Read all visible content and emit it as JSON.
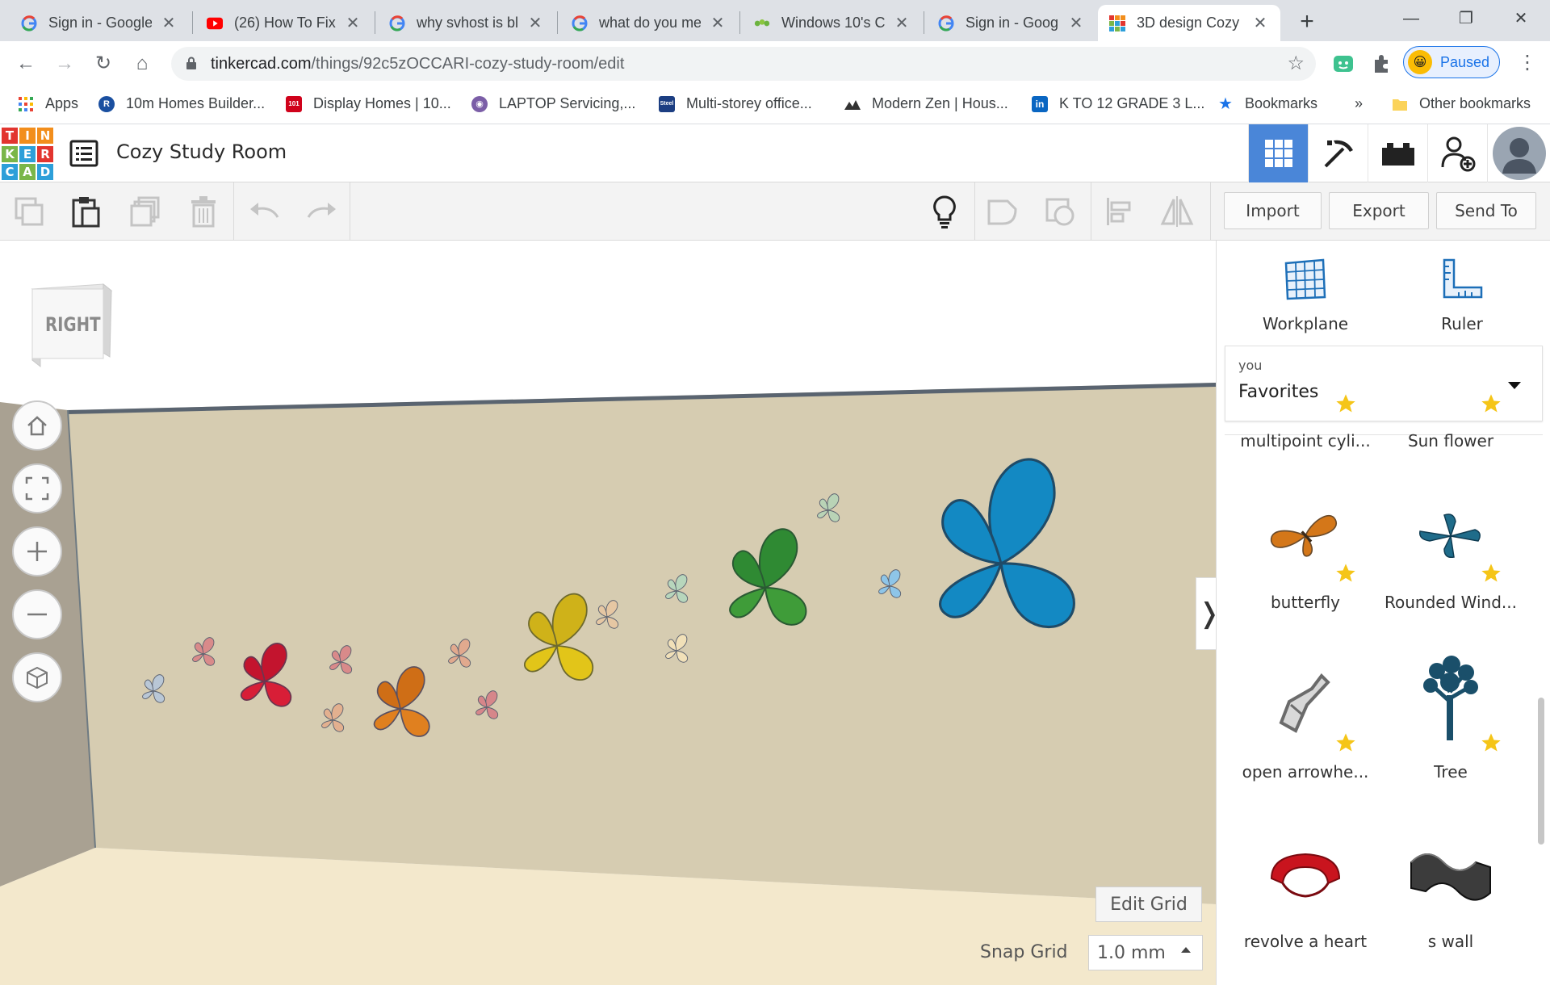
{
  "browser": {
    "tabs": [
      {
        "title": "Sign in - Google",
        "icon": "google-icon"
      },
      {
        "title": "(26) How To Fix",
        "icon": "youtube-icon"
      },
      {
        "title": "why svhost is bl",
        "icon": "google-icon"
      },
      {
        "title": "what do you me",
        "icon": "google-icon"
      },
      {
        "title": "Windows 10's C",
        "icon": "windows10-site-icon"
      },
      {
        "title": "Sign in - Google",
        "icon": "google-icon"
      },
      {
        "title": "3D design Cozy",
        "icon": "tinkercad-icon"
      }
    ],
    "url_host": "tinkercad.com",
    "url_path": "/things/92c5zOCCARI-cozy-study-room/edit",
    "profile_status": "Paused",
    "bookmarks": [
      {
        "label": "Apps"
      },
      {
        "label": "10m Homes Builder..."
      },
      {
        "label": "Display Homes | 10..."
      },
      {
        "label": "LAPTOP Servicing,..."
      },
      {
        "label": "Multi-storey office..."
      },
      {
        "label": "Modern Zen | Hous..."
      },
      {
        "label": "K TO 12 GRADE 3 L..."
      },
      {
        "label": "Bookmarks"
      },
      {
        "label": "»"
      },
      {
        "label": "Other bookmarks"
      }
    ],
    "bookmark_badges": {
      "display_homes": "101",
      "multi_storey": "Steel"
    }
  },
  "app": {
    "logo_letters": [
      "T",
      "I",
      "N",
      "K",
      "E",
      "R",
      "C",
      "A",
      "D"
    ],
    "logo_colors": [
      "#e2352f",
      "#f28e1c",
      "#f28e1c",
      "#7ab648",
      "#2d9fd9",
      "#e2352f",
      "#2d9fd9",
      "#7ab648",
      "#2d9fd9"
    ],
    "design_title": "Cozy Study Room",
    "accent": "#4a86d8"
  },
  "toolbar": {
    "import_label": "Import",
    "export_label": "Export",
    "send_to_label": "Send To"
  },
  "viewport": {
    "viewcube_label": "RIGHT",
    "edit_grid_label": "Edit Grid",
    "snap_grid_label": "Snap Grid",
    "snap_grid_value": "1.0 mm",
    "wall_color": "#d6ccb1",
    "floor_color": "#f3e8cc",
    "side_wall_color": "#a9a192"
  },
  "panel": {
    "workplane_label": "Workplane",
    "ruler_label": "Ruler",
    "library_owner": "you",
    "library_name": "Favorites",
    "partial_row": [
      "multipoint cyli...",
      "Sun flower"
    ],
    "shapes": [
      {
        "name": "butterfly",
        "icon": "butterfly-shape-icon"
      },
      {
        "name": "Rounded Wind...",
        "icon": "windmill-shape-icon"
      },
      {
        "name": "open arrowhe...",
        "icon": "arrowhead-shape-icon"
      },
      {
        "name": "Tree",
        "icon": "tree-shape-icon"
      },
      {
        "name": "revolve a heart",
        "icon": "heart-ring-shape-icon"
      },
      {
        "name": "s wall",
        "icon": "s-wall-shape-icon"
      }
    ]
  }
}
